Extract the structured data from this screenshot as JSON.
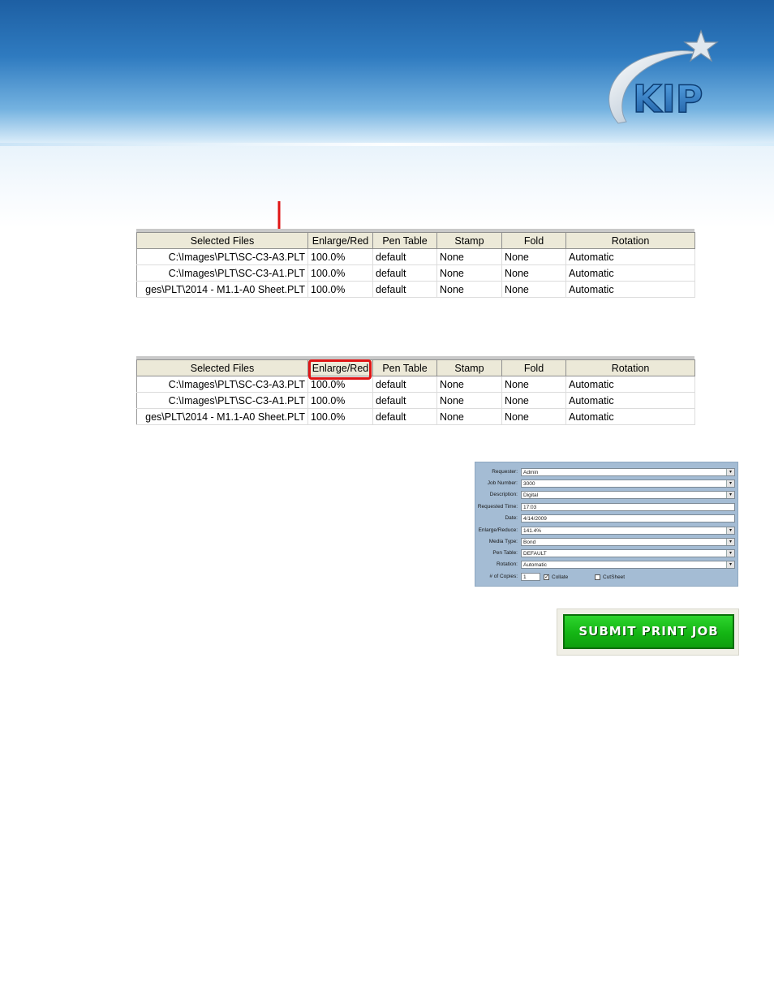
{
  "logo": {
    "text": "KIP"
  },
  "table_columns": [
    "Selected Files",
    "Enlarge/Red",
    "Pen Table",
    "Stamp",
    "Fold",
    "Rotation"
  ],
  "table_top": {
    "rows": [
      [
        "C:\\Images\\PLT\\SC-C3-A3.PLT",
        "100.0%",
        "default",
        "None",
        "None",
        "Automatic"
      ],
      [
        "C:\\Images\\PLT\\SC-C3-A1.PLT",
        "100.0%",
        "default",
        "None",
        "None",
        "Automatic"
      ],
      [
        "ges\\PLT\\2014 - M1.1-A0 Sheet.PLT",
        "100.0%",
        "default",
        "None",
        "None",
        "Automatic"
      ]
    ]
  },
  "table_bottom": {
    "rows": [
      [
        "C:\\Images\\PLT\\SC-C3-A3.PLT",
        "100.0%",
        "default",
        "None",
        "None",
        "Automatic"
      ],
      [
        "C:\\Images\\PLT\\SC-C3-A1.PLT",
        "100.0%",
        "default",
        "None",
        "None",
        "Automatic"
      ],
      [
        "ges\\PLT\\2014 - M1.1-A0 Sheet.PLT",
        "100.0%",
        "default",
        "None",
        "None",
        "Automatic"
      ]
    ]
  },
  "colors": {
    "highlight": "#e01515",
    "submit": "#14b514",
    "form_bg": "#a4bcd4"
  },
  "job_form": {
    "fields": [
      {
        "label": "Requester:",
        "value": "Admin",
        "dropdown": true
      },
      {
        "label": "Job Number:",
        "value": "3000",
        "dropdown": true
      },
      {
        "label": "Description:",
        "value": "Digital",
        "dropdown": true
      },
      {
        "label": "Requested Time:",
        "value": "17:03",
        "dropdown": false
      },
      {
        "label": "Date:",
        "value": "4/14/2009",
        "dropdown": false
      },
      {
        "label": "Enlarge/Reduce:",
        "value": "141.4%",
        "dropdown": true
      },
      {
        "label": "Media Type:",
        "value": "Bond",
        "dropdown": true
      },
      {
        "label": "Pen Table:",
        "value": "DEFAULT",
        "dropdown": true
      },
      {
        "label": "Rotation:",
        "value": "Automatic",
        "dropdown": true
      }
    ],
    "copies_label": "# of Copies:",
    "copies_value": "1",
    "collate_label": "Collate",
    "collate_checked": true,
    "cutsheet_label": "CutSheet",
    "cutsheet_checked": false
  },
  "submit_button": {
    "label": "SUBMIT PRINT JOB"
  }
}
